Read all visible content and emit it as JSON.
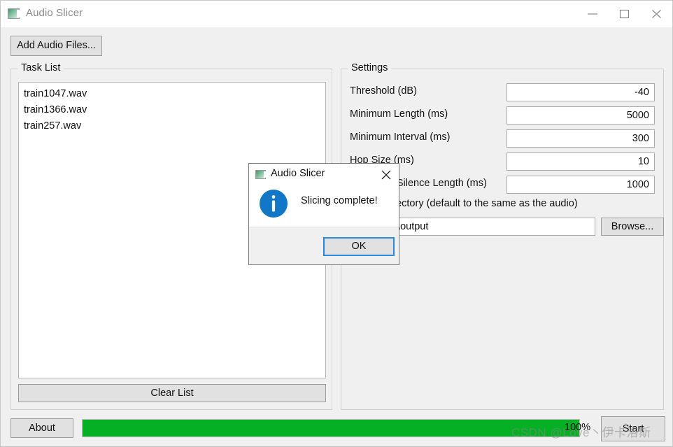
{
  "window": {
    "title": "Audio Slicer",
    "icon": "app-icon",
    "controls": {
      "minimize": "minimize-icon",
      "maximize": "maximize-icon",
      "close": "close-icon"
    }
  },
  "toolbar": {
    "add_audio_files": "Add Audio Files..."
  },
  "task_list": {
    "group_title": "Task List",
    "items": [
      "train1047.wav",
      "train1366.wav",
      "train257.wav"
    ],
    "clear_button": "Clear List"
  },
  "settings": {
    "group_title": "Settings",
    "rows": [
      {
        "label": "Threshold (dB)",
        "value": "-40"
      },
      {
        "label": "Minimum Length (ms)",
        "value": "5000"
      },
      {
        "label": "Minimum Interval (ms)",
        "value": "300"
      },
      {
        "label": "Hop Size (ms)",
        "value": "10"
      },
      {
        "label": "Maximum Silence Length (ms)",
        "value": "1000"
      }
    ],
    "output_dir_label": "Output Directory (default to the same as the audio)",
    "output_dir_value": "\\slicer-gui\\output",
    "browse_button": "Browse..."
  },
  "bottom_bar": {
    "about_button": "About",
    "progress_percent": "100%",
    "progress_value": 100,
    "start_button": "Start",
    "progress_color": "#06b025"
  },
  "dialog": {
    "title": "Audio Slicer",
    "icon": "app-icon",
    "close_icon": "close-icon",
    "info_icon": "info-icon",
    "message": "Slicing complete!",
    "ok_button": "OK",
    "focus_color": "#2a8ae0"
  },
  "watermark": {
    "text": "CSDN @Love丶伊卡洛斯"
  }
}
